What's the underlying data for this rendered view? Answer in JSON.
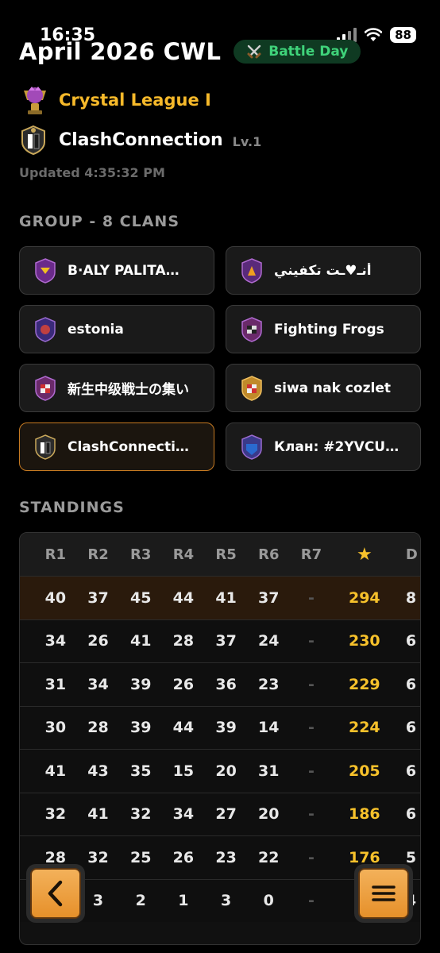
{
  "status": {
    "time": "16:35",
    "battery": "88"
  },
  "header": {
    "title": "April 2026 CWL",
    "badge": "Battle Day",
    "badge_icon": "crossed-swords-icon"
  },
  "league": {
    "name": "Crystal League I"
  },
  "clan": {
    "name": "ClashConnection",
    "level": "Lv.1"
  },
  "updated": "Updated 4:35:32 PM",
  "group": {
    "title": "GROUP - 8 CLANS",
    "clans": [
      {
        "name": "B·ALY PALITA…",
        "selected": false
      },
      {
        "name": "أنـ♥ـت تكفيني",
        "selected": false
      },
      {
        "name": "estonia",
        "selected": false
      },
      {
        "name": "Fighting Frogs",
        "selected": false
      },
      {
        "name": "新生中级戦士の集い",
        "selected": false
      },
      {
        "name": "siwa nak cozlet",
        "selected": false
      },
      {
        "name": "ClashConnecti…",
        "selected": true
      },
      {
        "name": "Клан: #2YVCU…",
        "selected": false
      }
    ]
  },
  "standings": {
    "title": "STANDINGS",
    "headers": [
      "R1",
      "R2",
      "R3",
      "R4",
      "R5",
      "R6",
      "R7",
      "★",
      "D"
    ],
    "rows": [
      [
        "40",
        "37",
        "45",
        "44",
        "41",
        "37",
        "-",
        "294",
        "8"
      ],
      [
        "34",
        "26",
        "41",
        "28",
        "37",
        "24",
        "-",
        "230",
        "6"
      ],
      [
        "31",
        "34",
        "39",
        "26",
        "36",
        "23",
        "-",
        "229",
        "6"
      ],
      [
        "30",
        "28",
        "39",
        "44",
        "39",
        "14",
        "-",
        "224",
        "6"
      ],
      [
        "41",
        "43",
        "35",
        "15",
        "20",
        "31",
        "-",
        "205",
        "6"
      ],
      [
        "32",
        "41",
        "32",
        "34",
        "27",
        "20",
        "-",
        "186",
        "6"
      ],
      [
        "28",
        "32",
        "25",
        "26",
        "23",
        "22",
        "-",
        "176",
        "5"
      ],
      [
        "",
        "3",
        "2",
        "1",
        "3",
        "0",
        "-",
        "",
        "4"
      ]
    ]
  },
  "colors": {
    "accent": "#f6b92a",
    "battle_day": "#3fd37a",
    "highlight_row": "#2a1a0c"
  }
}
